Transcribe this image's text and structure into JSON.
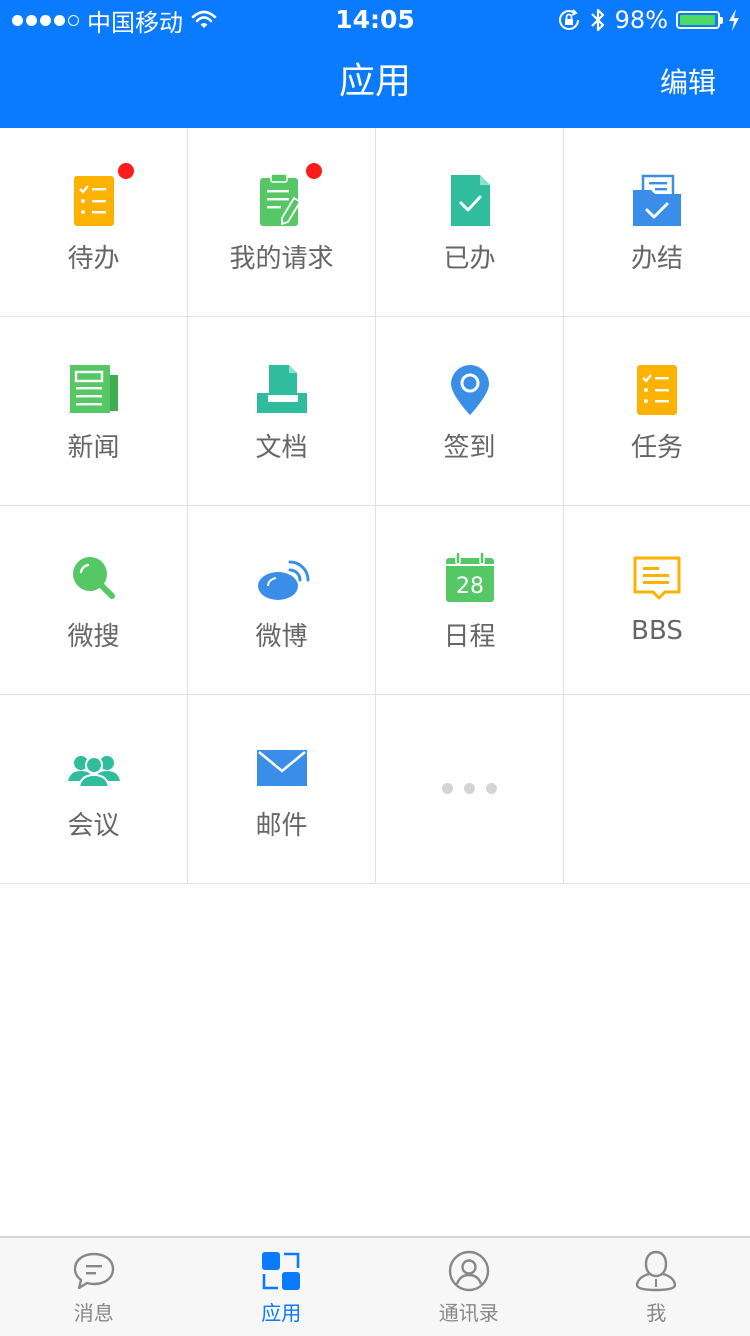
{
  "status_bar": {
    "carrier": "中国移动",
    "time": "14:05",
    "battery": "98%",
    "battery_level": 0.98
  },
  "nav": {
    "title": "应用",
    "edit": "编辑"
  },
  "apps": [
    {
      "label": "待办",
      "icon": "todo-list-icon",
      "badge": true
    },
    {
      "label": "我的请求",
      "icon": "clipboard-edit-icon",
      "badge": true
    },
    {
      "label": "已办",
      "icon": "done-document-icon",
      "badge": false
    },
    {
      "label": "办结",
      "icon": "completed-folder-icon",
      "badge": false
    },
    {
      "label": "新闻",
      "icon": "newspaper-icon",
      "badge": false
    },
    {
      "label": "文档",
      "icon": "document-tray-icon",
      "badge": false
    },
    {
      "label": "签到",
      "icon": "location-pin-icon",
      "badge": false
    },
    {
      "label": "任务",
      "icon": "task-list-icon",
      "badge": false
    },
    {
      "label": "微搜",
      "icon": "search-icon",
      "badge": false
    },
    {
      "label": "微博",
      "icon": "weibo-icon",
      "badge": false
    },
    {
      "label": "日程",
      "icon": "calendar-icon",
      "badge": false,
      "calendar_day": "28"
    },
    {
      "label": "BBS",
      "icon": "chat-board-icon",
      "badge": false
    },
    {
      "label": "会议",
      "icon": "meeting-people-icon",
      "badge": false
    },
    {
      "label": "邮件",
      "icon": "mail-icon",
      "badge": false
    }
  ],
  "tabs": [
    {
      "label": "消息",
      "icon": "message-icon",
      "active": false
    },
    {
      "label": "应用",
      "icon": "apps-icon",
      "active": true
    },
    {
      "label": "通讯录",
      "icon": "contacts-icon",
      "active": false
    },
    {
      "label": "我",
      "icon": "profile-icon",
      "active": false
    }
  ],
  "colors": {
    "primary": "#0a7aff",
    "orange": "#fdb101",
    "green": "#55c765",
    "teal": "#2fbd9e",
    "blue": "#3a8ee8",
    "badge": "#ff1b1b",
    "battery_fill": "#4cd964"
  }
}
